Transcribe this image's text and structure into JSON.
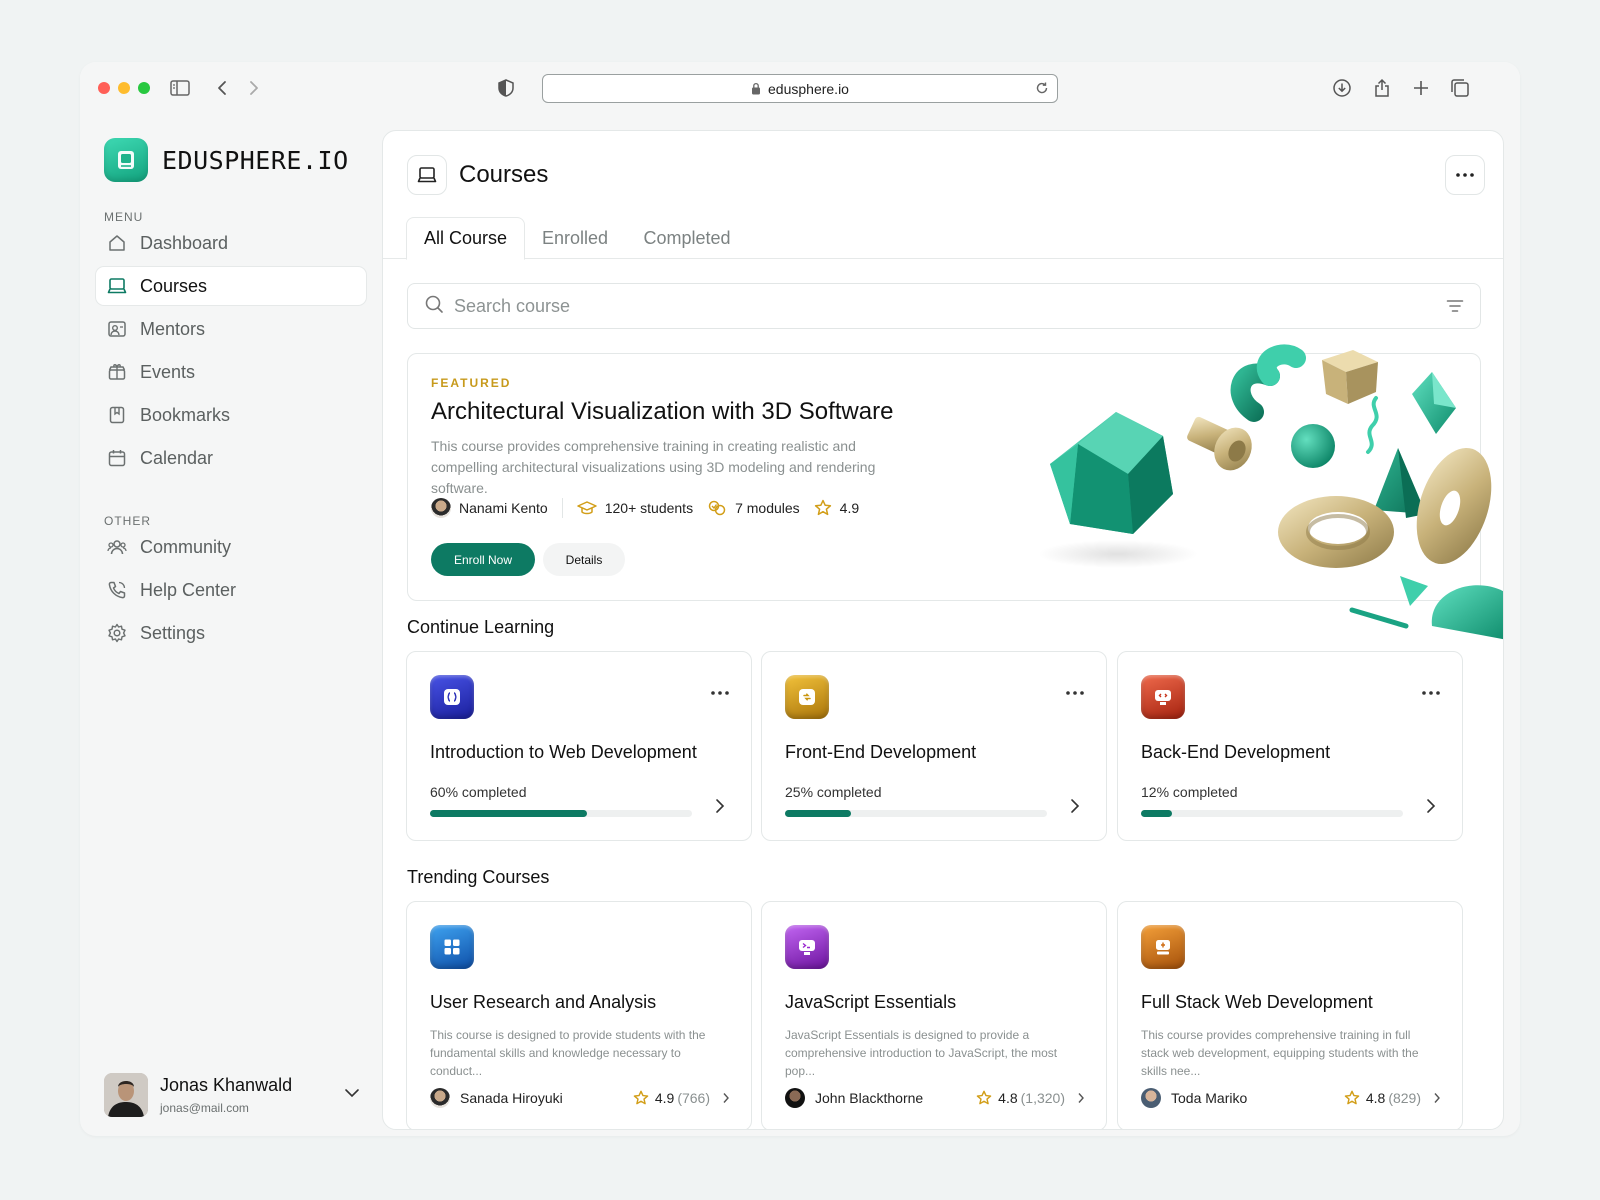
{
  "browser": {
    "url": "edusphere.io"
  },
  "brand": {
    "name": "EDUSPHERE.IO"
  },
  "sidebar": {
    "menu_label": "MENU",
    "other_label": "OTHER",
    "menu_items": [
      {
        "label": "Dashboard",
        "icon": "home-icon"
      },
      {
        "label": "Courses",
        "icon": "laptop-icon",
        "active": true
      },
      {
        "label": "Mentors",
        "icon": "mentor-icon"
      },
      {
        "label": "Events",
        "icon": "gift-icon"
      },
      {
        "label": "Bookmarks",
        "icon": "bookmark-icon"
      },
      {
        "label": "Calendar",
        "icon": "calendar-icon"
      }
    ],
    "other_items": [
      {
        "label": "Community",
        "icon": "users-icon"
      },
      {
        "label": "Help Center",
        "icon": "phone-icon"
      },
      {
        "label": "Settings",
        "icon": "gear-icon"
      }
    ],
    "user": {
      "name": "Jonas Khanwald",
      "email": "jonas@mail.com"
    }
  },
  "page": {
    "title": "Courses",
    "tabs": [
      "All Course",
      "Enrolled",
      "Completed"
    ],
    "active_tab": "All Course",
    "search_placeholder": "Search course"
  },
  "featured": {
    "tag": "FEATURED",
    "title": "Architectural Visualization with 3D Software",
    "description": "This course provides comprehensive training in creating realistic and compelling architectural visualizations using 3D modeling and rendering software.",
    "mentor": "Nanami Kento",
    "students": "120+ students",
    "modules": "7 modules",
    "rating": "4.9",
    "enroll_label": "Enroll Now",
    "details_label": "Details"
  },
  "continue_learning": {
    "title": "Continue Learning",
    "courses": [
      {
        "title": "Introduction to Web Development",
        "progress_text": "60% completed",
        "progress": 0.6,
        "color": "#2a2fb8",
        "icon": "code-braces-icon"
      },
      {
        "title": "Front-End Development",
        "progress_text": "25% completed",
        "progress": 0.25,
        "color": "#c9950f",
        "icon": "arrows-icon"
      },
      {
        "title": "Back-End Development",
        "progress_text": "12% completed",
        "progress": 0.12,
        "color": "#c8361e",
        "icon": "monitor-code-icon"
      }
    ]
  },
  "trending": {
    "title": "Trending Courses",
    "courses": [
      {
        "title": "User Research and Analysis",
        "description": "This course is designed to provide students with the fundamental skills and knowledge necessary to conduct...",
        "author": "Sanada Hiroyuki",
        "rating": "4.9",
        "count": "(766)",
        "color": "#1b6fd1",
        "icon": "grid-icon"
      },
      {
        "title": "JavaScript Essentials",
        "description": "JavaScript Essentials is designed to provide a comprehensive introduction to JavaScript, the most pop...",
        "author": "John Blackthorne",
        "rating": "4.8",
        "count": "(1,320)",
        "color": "#9a2bd0",
        "icon": "terminal-icon"
      },
      {
        "title": "Full Stack Web Development",
        "description": "This course provides comprehensive training in full stack web development, equipping students with the skills nee...",
        "author": "Toda Mariko",
        "rating": "4.8",
        "count": "(829)",
        "color": "#cf6d14",
        "icon": "server-icon"
      }
    ]
  },
  "colors": {
    "accent": "#0d7a63",
    "brand": "#1fbf95",
    "featured_tag": "#c79a1c",
    "star": "#e0a418"
  }
}
